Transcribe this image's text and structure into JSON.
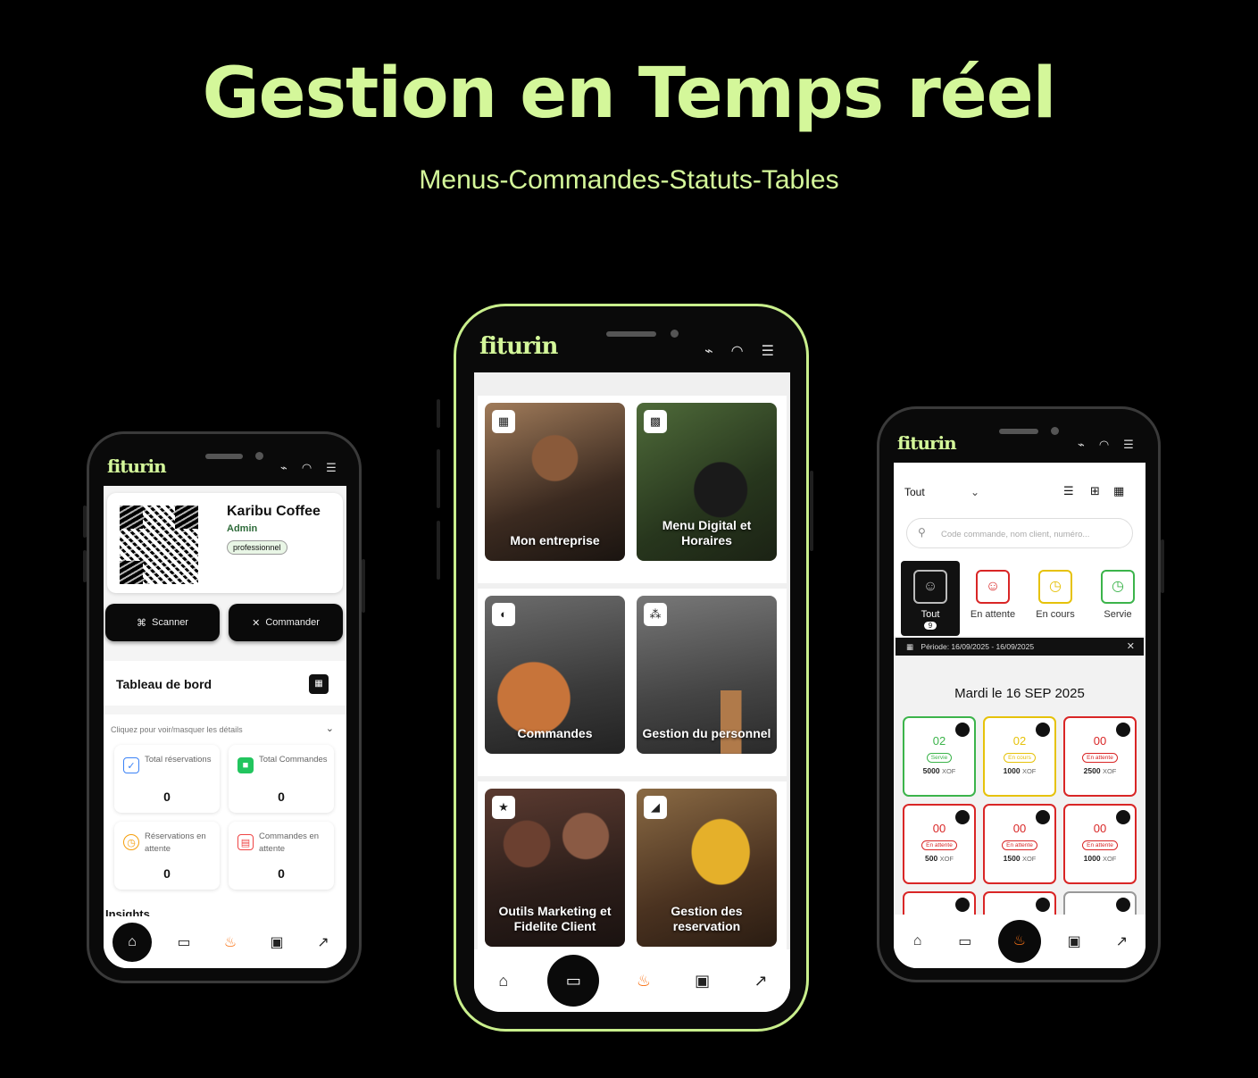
{
  "hero": {
    "title": "Gestion en Temps réel",
    "subtitle": "Menus-Commandes-Statuts-Tables"
  },
  "brand": "fiturin",
  "phone1": {
    "business_name": "Karibu Coffee",
    "role": "Admin",
    "plan_badge": "professionnel",
    "scanner_label": "Scanner",
    "commander_label": "Commander",
    "dashboard_title": "Tableau de bord",
    "toggle_hint": "Cliquez pour voir/masquer les détails",
    "stats": [
      {
        "label": "Total réservations",
        "value": "0",
        "icon": "calendar-check-icon",
        "color": "#3b82f6"
      },
      {
        "label": "Total Commandes",
        "value": "0",
        "icon": "bag-icon",
        "color": "#22c55e"
      },
      {
        "label": "Réservations en attente",
        "value": "0",
        "icon": "clock-icon",
        "color": "#f59e0b"
      },
      {
        "label": "Commandes en attente",
        "value": "0",
        "icon": "clipboard-icon",
        "color": "#ef4444"
      }
    ],
    "insights_label": "Insights"
  },
  "phone2": {
    "tiles": [
      {
        "caption": "Mon entreprise",
        "icon": "building-icon"
      },
      {
        "caption": "Menu Digital et Horaires",
        "icon": "qr-icon"
      },
      {
        "caption": "Commandes",
        "icon": "dish-icon"
      },
      {
        "caption": "Gestion du personnel",
        "icon": "team-icon"
      },
      {
        "caption": "Outils Marketing et Fidelite Client",
        "icon": "star-user-icon"
      },
      {
        "caption": "Gestion des reservation",
        "icon": "megaphone-icon"
      }
    ]
  },
  "phone3": {
    "filter_value": "Tout",
    "search_placeholder": "Code commande, nom client, numéro...",
    "status_tabs": [
      {
        "label": "Tout",
        "count": "9",
        "color": "#111111"
      },
      {
        "label": "En attente",
        "color": "#d92626"
      },
      {
        "label": "En cours",
        "color": "#e6c20a"
      },
      {
        "label": "Servie",
        "color": "#3cb44b"
      }
    ],
    "period": "Période: 16/09/2025 - 16/09/2025",
    "date_heading": "Mardi le 16 SEP 2025",
    "tables": [
      {
        "num": "02",
        "status": "Servie",
        "amount": "5000",
        "currency": "XOF",
        "color": "#3cb44b"
      },
      {
        "num": "02",
        "status": "En cours",
        "amount": "1000",
        "currency": "XOF",
        "color": "#e6c20a"
      },
      {
        "num": "00",
        "status": "En attente",
        "amount": "2500",
        "currency": "XOF",
        "color": "#d92626"
      },
      {
        "num": "00",
        "status": "En attente",
        "amount": "500",
        "currency": "XOF",
        "color": "#d92626"
      },
      {
        "num": "00",
        "status": "En attente",
        "amount": "1500",
        "currency": "XOF",
        "color": "#d92626"
      },
      {
        "num": "00",
        "status": "En attente",
        "amount": "1000",
        "currency": "XOF",
        "color": "#d92626"
      }
    ]
  },
  "colors": {
    "accent": "#d4f79a",
    "fire": "#f97316"
  }
}
